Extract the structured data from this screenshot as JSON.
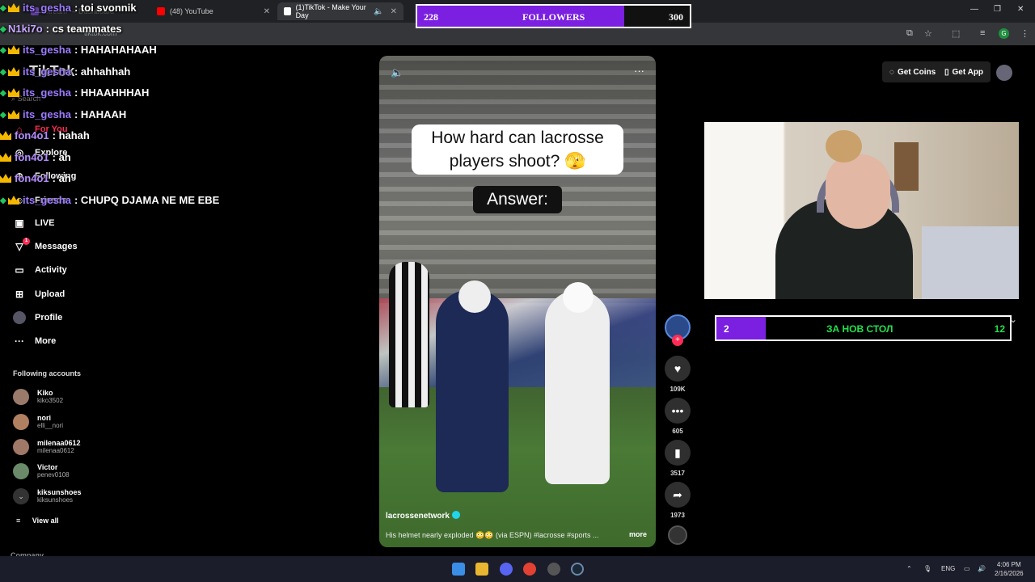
{
  "browser": {
    "tabs": [
      {
        "label": "Stream — Dashboard",
        "favicon_color": "#6441a5"
      },
      {
        "label": "(48) YouTube",
        "favicon_color": "#ff0000"
      },
      {
        "label": "(1)TikTok - Make Your Day",
        "favicon_color": "#ffffff"
      }
    ],
    "url": "tiktok.com"
  },
  "followers_goal": {
    "current": "228",
    "label": "FOLLOWERS",
    "target": "300",
    "progress": 0.76
  },
  "chat": [
    {
      "user": "its_gesha",
      "color": "#9c7bff",
      "message": ": toi svonnik"
    },
    {
      "user": "N1ki7o",
      "color": "#c8a8ff",
      "message": ": cs teammates"
    },
    {
      "user": "its_gesha",
      "color": "#9c7bff",
      "message": ": HAHAHAHAAH"
    },
    {
      "user": "its_gesha",
      "color": "#9c7bff",
      "message": ": ahhahhah"
    },
    {
      "user": "its_gesha",
      "color": "#9c7bff",
      "message": ": HHAAHHHAH"
    },
    {
      "user": "its_gesha",
      "color": "#9c7bff",
      "message": ": HAHAAH"
    },
    {
      "user": "fon4o1",
      "color": "#b58cff",
      "message": ": hahah"
    },
    {
      "user": "fon4o1",
      "color": "#b58cff",
      "message": ": ah"
    },
    {
      "user": "fon4o1",
      "color": "#b58cff",
      "message": ": ah"
    },
    {
      "user": "its_gesha",
      "color": "#9c7bff",
      "message": ": CHUPQ DJAMA NE ME EBE"
    }
  ],
  "tiktok": {
    "logo": "TikTok",
    "search_placeholder": "Search",
    "nav": {
      "for_you": "For You",
      "explore": "Explore",
      "following": "Following",
      "friends": "Friends",
      "live": "LIVE",
      "messages": "Messages",
      "messages_badge": "1",
      "activity": "Activity",
      "upload": "Upload",
      "profile": "Profile",
      "more": "More"
    },
    "following_header": "Following accounts",
    "accounts": [
      {
        "name": "Kiko",
        "handle": "kiko3502"
      },
      {
        "name": "nori",
        "handle": "elli__nori"
      },
      {
        "name": "milenaa0612",
        "handle": "milenaa0612"
      },
      {
        "name": "Victor",
        "handle": "penev0108"
      },
      {
        "name": "kiksunshoes",
        "handle": "kiksunshoes"
      }
    ],
    "view_all": "View all",
    "company": "Company",
    "get_coins": "Get Coins",
    "get_app": "Get App"
  },
  "video": {
    "caption": "How hard can lacrosse players shoot? 🫣",
    "answer": "Answer:",
    "author": "lacrossenetwork",
    "description": "His helmet nearly exploded 😳😳 (via ESPN) #lacrosse #sports ...",
    "more": "more",
    "likes": "109K",
    "comments": "605",
    "saves": "3517",
    "shares": "1973"
  },
  "stream_goal": {
    "current": "2",
    "label": "ЗА НОВ СТОЛ",
    "target": "12",
    "progress": 0.1667
  },
  "taskbar": {
    "lang": "ENG",
    "time": "4:06 PM",
    "date": "2/16/2026"
  }
}
